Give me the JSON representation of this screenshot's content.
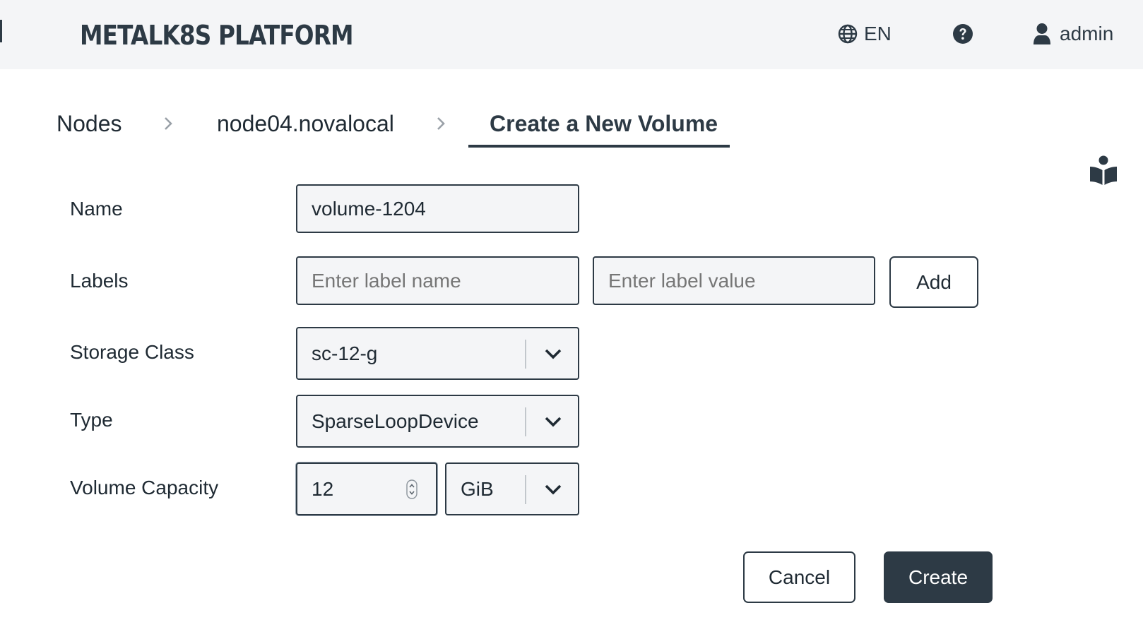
{
  "app": {
    "brand": "METALK8S PLATFORM"
  },
  "header": {
    "language": "EN",
    "language_icon": "globe-icon",
    "help_icon": "question-circle-icon",
    "user_icon": "user-icon",
    "user_name": "admin"
  },
  "breadcrumb": {
    "items": [
      "Nodes",
      "node04.novalocal",
      "Create a New Volume"
    ],
    "separator_icon": "chevron-right-icon"
  },
  "side": {
    "doc_icon": "book-reader-icon"
  },
  "form": {
    "name": {
      "label": "Name",
      "value": "volume-1204"
    },
    "labels": {
      "label": "Labels",
      "name_placeholder": "Enter label name",
      "value_placeholder": "Enter label value",
      "add_label": "Add"
    },
    "storage_class": {
      "label": "Storage Class",
      "value": "sc-12-g"
    },
    "type": {
      "label": "Type",
      "value": "SparseLoopDevice"
    },
    "capacity": {
      "label": "Volume Capacity",
      "value": "12",
      "unit": "GiB"
    },
    "cancel_label": "Cancel",
    "create_label": "Create"
  },
  "colors": {
    "primary": "#2d3a45",
    "header_bg": "#f4f5f7",
    "field_bg": "#f4f5f7",
    "placeholder": "#767676"
  }
}
